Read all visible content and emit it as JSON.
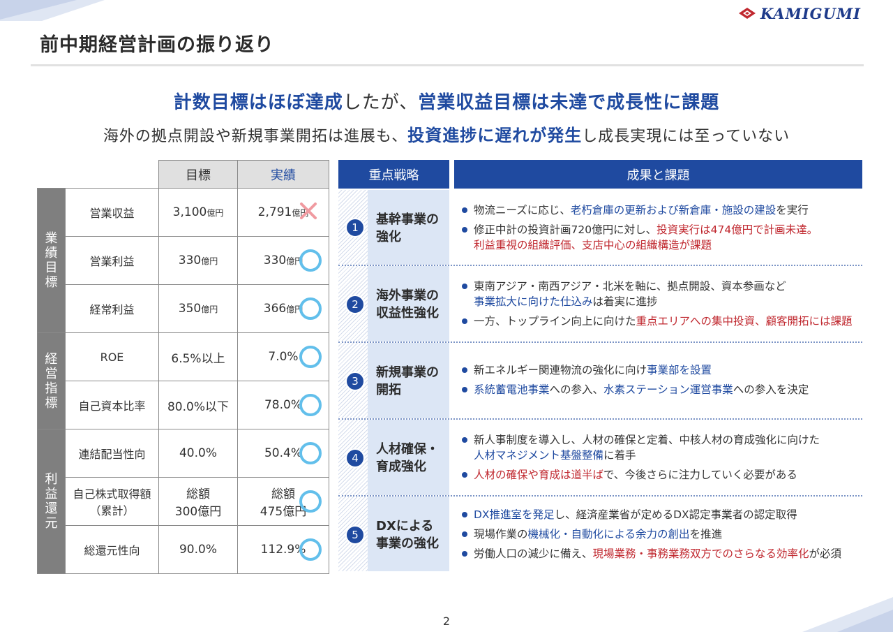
{
  "header": {
    "title": "前中期経営計画の振り返り",
    "logo_text": "KAMIGUMI"
  },
  "headline": {
    "part1": "計数目標はほぼ達成",
    "part2": "したが、",
    "part3": "営業収益目標は未達で成長性に課題"
  },
  "subline": {
    "part1": "海外の拠点開設や新規事業開拓は進展も、",
    "part2": "投資進捗に遅れが発生",
    "part3": "し成長実現には至っていない"
  },
  "kpi_table": {
    "col_target": "目標",
    "col_actual": "実績",
    "groups": [
      {
        "label": "業績目標",
        "rows": [
          {
            "item": "営業収益",
            "target": "3,100",
            "target_unit": "億円",
            "actual": "2,791",
            "actual_unit": "億円",
            "mark": "cross"
          },
          {
            "item": "営業利益",
            "target": "330",
            "target_unit": "億円",
            "actual": "330",
            "actual_unit": "億円",
            "mark": "circle"
          },
          {
            "item": "経常利益",
            "target": "350",
            "target_unit": "億円",
            "actual": "366",
            "actual_unit": "億円",
            "mark": "circle"
          }
        ]
      },
      {
        "label": "経営指標",
        "rows": [
          {
            "item": "ROE",
            "target": "6.5%以上",
            "actual": "7.0%",
            "mark": "circle"
          },
          {
            "item": "自己資本比率",
            "target": "80.0%以下",
            "actual": "78.0%",
            "mark": "circle"
          }
        ]
      },
      {
        "label": "利益還元",
        "rows": [
          {
            "item": "連結配当性向",
            "target": "40.0%",
            "actual": "50.4%",
            "mark": "circle"
          },
          {
            "item": "自己株式取得額",
            "item2": "（累計）",
            "target": "総額",
            "target2": "300億円",
            "actual": "総額",
            "actual2": "475億円",
            "mark": "circle"
          },
          {
            "item": "総還元性向",
            "target": "90.0%",
            "actual": "112.9%",
            "mark": "circle"
          }
        ]
      }
    ]
  },
  "strategy_panel": {
    "header_strategy": "重点戦略",
    "header_results": "成果と課題",
    "items": [
      {
        "num": "1",
        "name1": "基幹事業の",
        "name2": "強化",
        "b1": {
          "t1": "物流ニーズに応じ、",
          "t2": "老朽倉庫の更新および新倉庫・施設の建設",
          "t3": "を実行"
        },
        "b2": {
          "t1": "修正中計の投資計画720億円に対し、",
          "t2": "投資実行は474億円で計画未達。",
          "t3": "利益重視の組織評価、支店中心の組織構造が課題"
        }
      },
      {
        "num": "2",
        "name1": "海外事業の",
        "name2": "収益性強化",
        "b1": {
          "t1": "東南アジア・南西アジア・北米を軸に、拠点開設、資本参画など",
          "t2": "事業拡大に向けた仕込み",
          "t3": "は着実に進捗"
        },
        "b2": {
          "t1": "一方、トップライン向上に向けた",
          "t2": "重点エリアへの集中投資、顧客開拓には課題"
        }
      },
      {
        "num": "3",
        "name1": "新規事業の",
        "name2": "開拓",
        "b1": {
          "t1": "新エネルギー関連物流の強化に向け",
          "t2": "事業部を設置"
        },
        "b2": {
          "t1": "系統蓄電池事業",
          "t2": "への参入、",
          "t3": "水素ステーション運営事業",
          "t4": "への参入を決定"
        }
      },
      {
        "num": "4",
        "name1": "人材確保・",
        "name2": "育成強化",
        "b1": {
          "t1": "新人事制度を導入し、人材の確保と定着、中核人材の育成強化に向けた",
          "t2": "人材マネジメント基盤整備",
          "t3": "に着手"
        },
        "b2": {
          "t1": "人材の確保や育成は道半ば",
          "t2": "で、今後さらに注力していく必要がある"
        }
      },
      {
        "num": "5",
        "name1": "DXによる",
        "name2": "事業の強化",
        "b1": {
          "t1": "DX推進室を発足",
          "t2": "し、経済産業省が定めるDX認定事業者の認定取得"
        },
        "b2": {
          "t1": "現場作業の",
          "t2": "機械化・自動化による余力の創出",
          "t3": "を推進"
        },
        "b3": {
          "t1": "労働人口の減少に備え、",
          "t2": "現場業務・事務業務双方でのさらなる効率化",
          "t3": "が必須"
        }
      }
    ]
  },
  "footer": {
    "page_number": "2"
  },
  "colors": {
    "brand_blue": "#1f4aa0",
    "accent_red": "#c0282f",
    "circle_mark": "#62bfeb",
    "cross_mark": "#f09aa0",
    "group_gray": "#7f7f7f",
    "strategy_bg": "#dce6f5"
  }
}
